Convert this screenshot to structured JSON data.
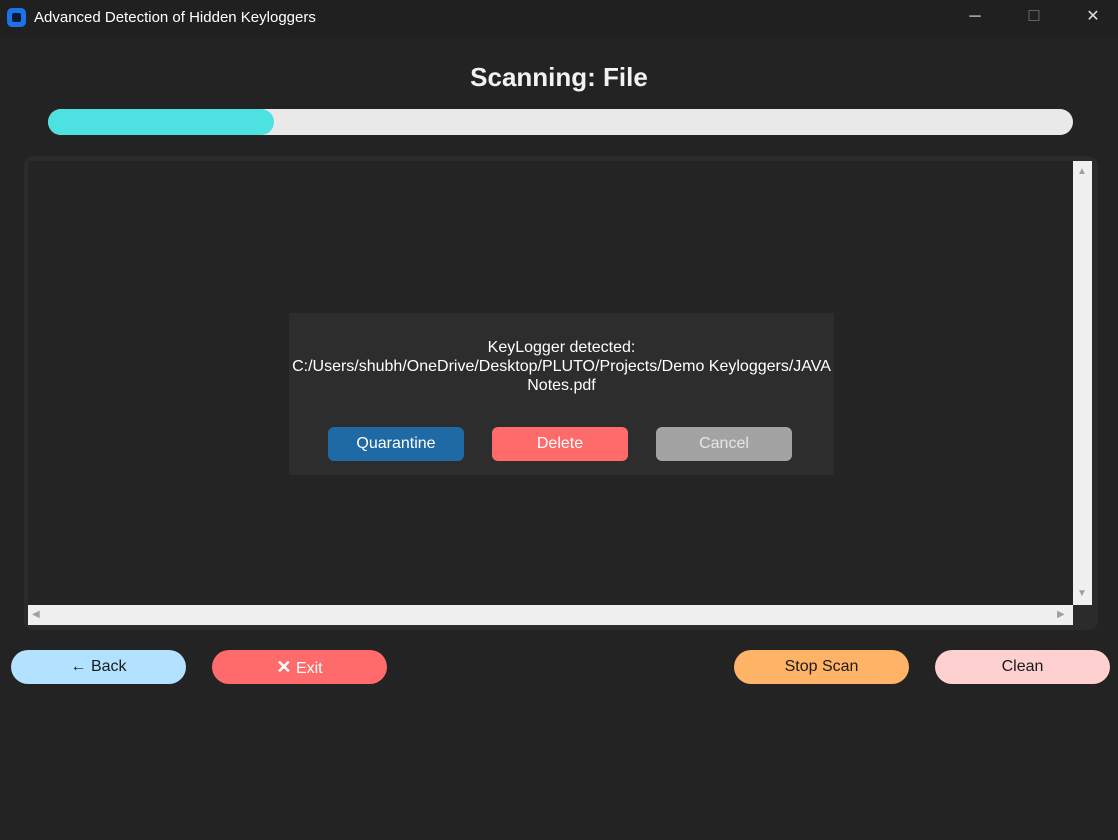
{
  "window": {
    "title": "Advanced Detection of Hidden Keyloggers",
    "minimize": "─",
    "maximize": "☐",
    "close": "✕"
  },
  "header": {
    "title": "Scanning: File"
  },
  "progress": {
    "fraction": 0.22
  },
  "dialog": {
    "line1": "KeyLogger detected:",
    "line2": "C:/Users/shubh/OneDrive/Desktop/PLUTO/Projects/Demo Keyloggers/JAVA",
    "line3": "Notes.pdf",
    "quarantine": "Quarantine",
    "delete": "Delete",
    "cancel": "Cancel"
  },
  "scrollbars": {
    "up": "▲",
    "down": "▼",
    "left": "◀",
    "right": "▶"
  },
  "footer": {
    "back_icon": "←",
    "back_label": "Back",
    "exit_icon": "✕",
    "exit_label": "Exit",
    "stop_label": "Stop Scan",
    "clean_label": "Clean"
  },
  "colors": {
    "background": "#232323",
    "progress_fill": "#4ee1e1",
    "quarantine": "#1f6aa5",
    "delete": "#ff6b6b",
    "cancel": "#a3a3a3",
    "back": "#b2e2ff",
    "exit": "#ff6b6b",
    "stop": "#ffb366",
    "clean": "#ffd0d0"
  }
}
